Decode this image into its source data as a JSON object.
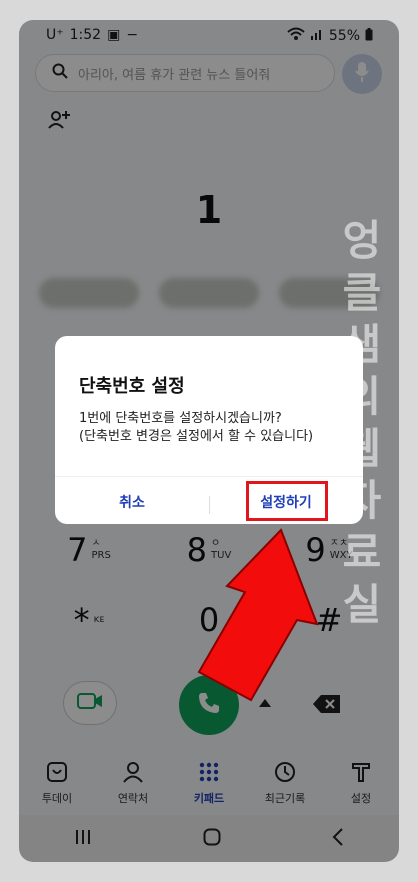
{
  "status": {
    "carrier": "U⁺",
    "time": "1:52",
    "battery": "55%"
  },
  "search": {
    "placeholder": "아리아, 여름 휴가 관련 뉴스 틀어줘"
  },
  "dial": {
    "number": "1"
  },
  "keypad": [
    {
      "digit": "7",
      "sub1": "ㅅ",
      "sub2": "PRS"
    },
    {
      "digit": "8",
      "sub1": "ㅇ",
      "sub2": "TUV"
    },
    {
      "digit": "9",
      "sub1": "ㅈㅊ",
      "sub2": "WXY"
    },
    {
      "digit": "*",
      "sub1": "ᴋᴇ",
      "sub2": ""
    },
    {
      "digit": "0",
      "sub1": "",
      "sub2": ""
    },
    {
      "digit": "#",
      "sub1": "",
      "sub2": ""
    }
  ],
  "navtabs": [
    {
      "label": "투데이"
    },
    {
      "label": "연락처"
    },
    {
      "label": "키패드"
    },
    {
      "label": "최근기록"
    },
    {
      "label": "설정"
    }
  ],
  "dialog": {
    "title": "단축번호 설정",
    "message_line1": "1번에 단축번호를 설정하시겠습니까?",
    "message_line2": "(단축번호 변경은 설정에서 할 수 있습니다)",
    "cancel_label": "취소",
    "confirm_label": "설정하기"
  },
  "watermark": {
    "text": "엉클샘의 웹자료실"
  },
  "colors": {
    "accent": "#1f3fb8",
    "call": "#10a35a",
    "highlight": "#e0161c"
  }
}
